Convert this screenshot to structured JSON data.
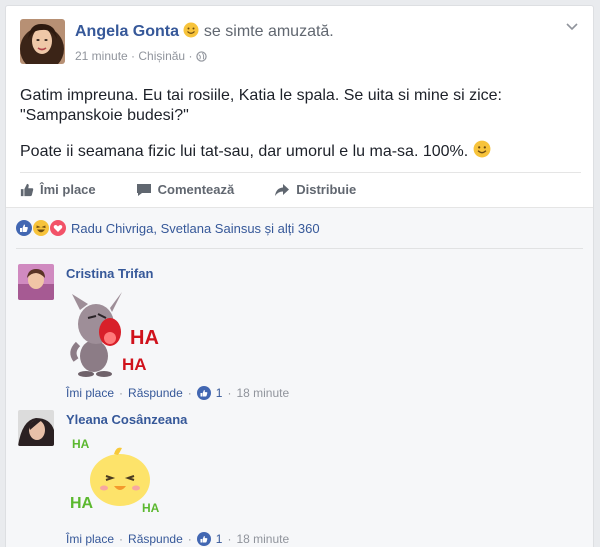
{
  "post": {
    "author": "Angela Gonta",
    "feeling": "se simte amuzată.",
    "time": "21 minute",
    "location": "Chișinău",
    "paragraph1_line1": "Gatim impreuna. Eu tai rosiile, Katia le spala. Se uita si mine si zice:",
    "paragraph1_line2": "\"Sampanskoie budesi?\"",
    "paragraph2": "Poate ii seamana fizic lui tat-sau, dar umorul e lu ma-sa. 100%."
  },
  "actions": {
    "like": "Îmi place",
    "comment": "Comentează",
    "share": "Distribuie"
  },
  "reactions": {
    "summary": "Radu Chivriga, Svetlana Sainsus și alți 360"
  },
  "comments": [
    {
      "name": "Cristina Trifan",
      "sticker_text": [
        "HA",
        "HA"
      ],
      "like_label": "Îmi place",
      "reply_label": "Răspunde",
      "likes": "1",
      "time": "18 minute"
    },
    {
      "name": "Yleana Cosânzeana",
      "sticker_text": [
        "HA",
        "HA",
        "HA"
      ],
      "like_label": "Îmi place",
      "reply_label": "Răspunde",
      "likes": "1",
      "time": "18 minute"
    }
  ],
  "colors": {
    "link": "#365899",
    "meta": "#90949c",
    "like_blue": "#4267b2",
    "love_red": "#f25268",
    "haha_yellow": "#f7c33b"
  },
  "icons": [
    "chevron-down-icon",
    "globe-icon",
    "like-icon",
    "comment-icon",
    "share-icon",
    "like-reaction-icon",
    "haha-reaction-icon",
    "love-reaction-icon",
    "smile-emoji-icon"
  ]
}
